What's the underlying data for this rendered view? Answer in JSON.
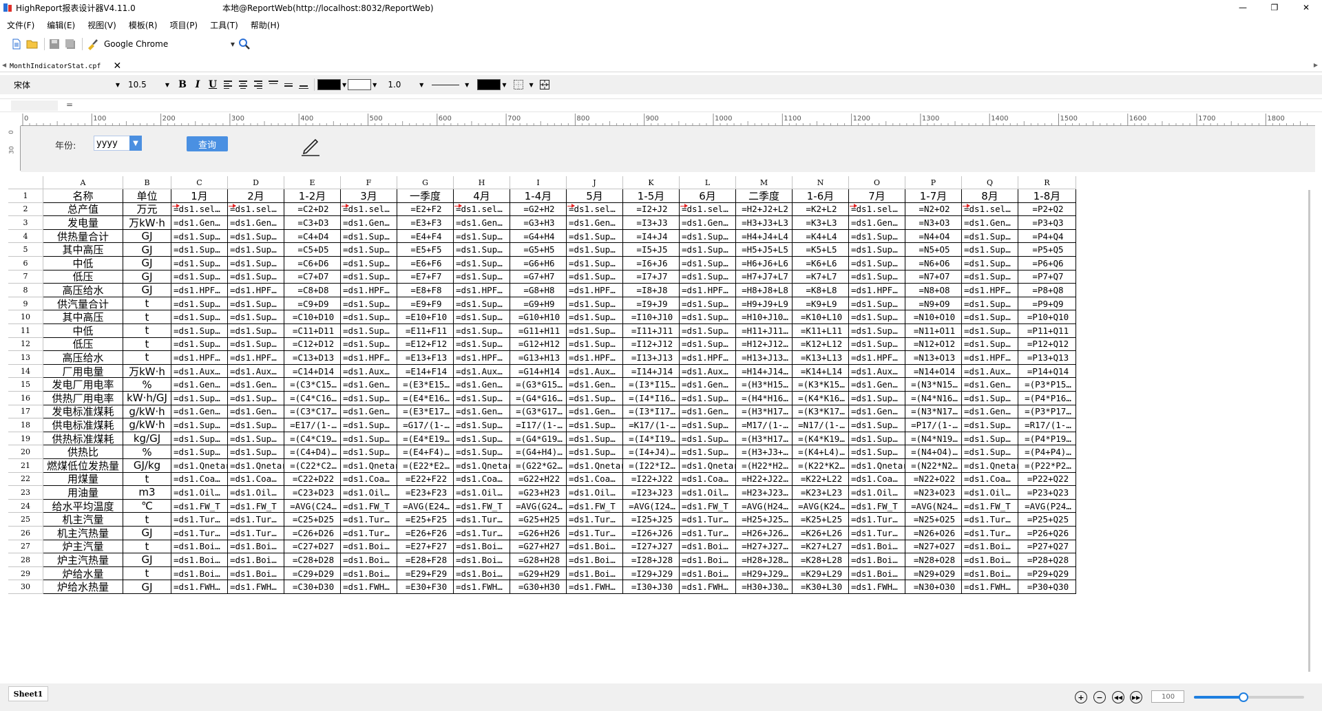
{
  "window": {
    "app_title": "HighReport报表设计器V4.11.0",
    "path_title": "本地@ReportWeb(http://localhost:8032/ReportWeb)",
    "min": "—",
    "max": "❐",
    "close": "✕"
  },
  "menu": [
    "文件(F)",
    "编辑(E)",
    "视图(V)",
    "模板(R)",
    "项目(P)",
    "工具(T)",
    "帮助(H)"
  ],
  "toolbar": {
    "browser": "Google Chrome"
  },
  "file_tab": {
    "name": "MonthIndicatorStat.cpf",
    "close": "✕"
  },
  "format_bar": {
    "font": "宋体",
    "size": "10.5",
    "bold": "B",
    "italic": "I",
    "underline": "U",
    "line_width": "1.0",
    "fg_color": "#000000",
    "bg_color": "#ffffff"
  },
  "formula_bar": {
    "eq": "="
  },
  "ruler": {
    "ticks": [
      "0",
      "100",
      "200",
      "300",
      "400",
      "500",
      "600",
      "700",
      "800",
      "900",
      "1000",
      "1100",
      "1200",
      "1300",
      "1400",
      "1500",
      "1600",
      "1700",
      "1800"
    ],
    "v_ticks": [
      "0",
      "30"
    ]
  },
  "params": {
    "year_label": "年份:",
    "year_value": "yyyy",
    "query_button": "查询"
  },
  "grid": {
    "columns": [
      "A",
      "B",
      "C",
      "D",
      "E",
      "F",
      "G",
      "H",
      "I",
      "J",
      "K",
      "L",
      "M",
      "N",
      "O",
      "P",
      "Q",
      "R"
    ],
    "rows": [
      {
        "n": "1",
        "c": [
          "名称",
          "单位",
          "1月",
          "2月",
          "1-2月",
          "3月",
          "一季度",
          "4月",
          "1-4月",
          "5月",
          "1-5月",
          "6月",
          "二季度",
          "1-6月",
          "7月",
          "1-7月",
          "8月",
          "1-8月"
        ]
      },
      {
        "n": "2",
        "c": [
          "总产值",
          "万元",
          "=ds1.sel…",
          "=ds1.sel…",
          "=C2+D2",
          "=ds1.sel…",
          "=E2+F2",
          "=ds1.sel…",
          "=G2+H2",
          "=ds1.sel…",
          "=I2+J2",
          "=ds1.sel…",
          "=H2+J2+L2",
          "=K2+L2",
          "=ds1.sel…",
          "=N2+O2",
          "=ds1.sel…",
          "=P2+Q2"
        ]
      },
      {
        "n": "3",
        "c": [
          "发电量",
          "万kW·h",
          "=ds1.Gen…",
          "=ds1.Gen…",
          "=C3+D3",
          "=ds1.Gen…",
          "=E3+F3",
          "=ds1.Gen…",
          "=G3+H3",
          "=ds1.Gen…",
          "=I3+J3",
          "=ds1.Gen…",
          "=H3+J3+L3",
          "=K3+L3",
          "=ds1.Gen…",
          "=N3+O3",
          "=ds1.Gen…",
          "=P3+Q3"
        ]
      },
      {
        "n": "4",
        "c": [
          "供热量合计",
          "GJ",
          "=ds1.Sup…",
          "=ds1.Sup…",
          "=C4+D4",
          "=ds1.Sup…",
          "=E4+F4",
          "=ds1.Sup…",
          "=G4+H4",
          "=ds1.Sup…",
          "=I4+J4",
          "=ds1.Sup…",
          "=H4+J4+L4",
          "=K4+L4",
          "=ds1.Sup…",
          "=N4+O4",
          "=ds1.Sup…",
          "=P4+Q4"
        ]
      },
      {
        "n": "5",
        "c": [
          "其中高压",
          "GJ",
          "=ds1.Sup…",
          "=ds1.Sup…",
          "=C5+D5",
          "=ds1.Sup…",
          "=E5+F5",
          "=ds1.Sup…",
          "=G5+H5",
          "=ds1.Sup…",
          "=I5+J5",
          "=ds1.Sup…",
          "=H5+J5+L5",
          "=K5+L5",
          "=ds1.Sup…",
          "=N5+O5",
          "=ds1.Sup…",
          "=P5+Q5"
        ]
      },
      {
        "n": "6",
        "c": [
          "中低",
          "GJ",
          "=ds1.Sup…",
          "=ds1.Sup…",
          "=C6+D6",
          "=ds1.Sup…",
          "=E6+F6",
          "=ds1.Sup…",
          "=G6+H6",
          "=ds1.Sup…",
          "=I6+J6",
          "=ds1.Sup…",
          "=H6+J6+L6",
          "=K6+L6",
          "=ds1.Sup…",
          "=N6+O6",
          "=ds1.Sup…",
          "=P6+Q6"
        ]
      },
      {
        "n": "7",
        "c": [
          "低压",
          "GJ",
          "=ds1.Sup…",
          "=ds1.Sup…",
          "=C7+D7",
          "=ds1.Sup…",
          "=E7+F7",
          "=ds1.Sup…",
          "=G7+H7",
          "=ds1.Sup…",
          "=I7+J7",
          "=ds1.Sup…",
          "=H7+J7+L7",
          "=K7+L7",
          "=ds1.Sup…",
          "=N7+O7",
          "=ds1.Sup…",
          "=P7+Q7"
        ]
      },
      {
        "n": "8",
        "c": [
          "高压给水",
          "GJ",
          "=ds1.HPF…",
          "=ds1.HPF…",
          "=C8+D8",
          "=ds1.HPF…",
          "=E8+F8",
          "=ds1.HPF…",
          "=G8+H8",
          "=ds1.HPF…",
          "=I8+J8",
          "=ds1.HPF…",
          "=H8+J8+L8",
          "=K8+L8",
          "=ds1.HPF…",
          "=N8+O8",
          "=ds1.HPF…",
          "=P8+Q8"
        ]
      },
      {
        "n": "9",
        "c": [
          "供汽量合计",
          "t",
          "=ds1.Sup…",
          "=ds1.Sup…",
          "=C9+D9",
          "=ds1.Sup…",
          "=E9+F9",
          "=ds1.Sup…",
          "=G9+H9",
          "=ds1.Sup…",
          "=I9+J9",
          "=ds1.Sup…",
          "=H9+J9+L9",
          "=K9+L9",
          "=ds1.Sup…",
          "=N9+O9",
          "=ds1.Sup…",
          "=P9+Q9"
        ]
      },
      {
        "n": "10",
        "c": [
          "其中高压",
          "t",
          "=ds1.Sup…",
          "=ds1.Sup…",
          "=C10+D10",
          "=ds1.Sup…",
          "=E10+F10",
          "=ds1.Sup…",
          "=G10+H10",
          "=ds1.Sup…",
          "=I10+J10",
          "=ds1.Sup…",
          "=H10+J10…",
          "=K10+L10",
          "=ds1.Sup…",
          "=N10+O10",
          "=ds1.Sup…",
          "=P10+Q10"
        ]
      },
      {
        "n": "11",
        "c": [
          "中低",
          "t",
          "=ds1.Sup…",
          "=ds1.Sup…",
          "=C11+D11",
          "=ds1.Sup…",
          "=E11+F11",
          "=ds1.Sup…",
          "=G11+H11",
          "=ds1.Sup…",
          "=I11+J11",
          "=ds1.Sup…",
          "=H11+J11…",
          "=K11+L11",
          "=ds1.Sup…",
          "=N11+O11",
          "=ds1.Sup…",
          "=P11+Q11"
        ]
      },
      {
        "n": "12",
        "c": [
          "低压",
          "t",
          "=ds1.Sup…",
          "=ds1.Sup…",
          "=C12+D12",
          "=ds1.Sup…",
          "=E12+F12",
          "=ds1.Sup…",
          "=G12+H12",
          "=ds1.Sup…",
          "=I12+J12",
          "=ds1.Sup…",
          "=H12+J12…",
          "=K12+L12",
          "=ds1.Sup…",
          "=N12+O12",
          "=ds1.Sup…",
          "=P12+Q12"
        ]
      },
      {
        "n": "13",
        "c": [
          "高压给水",
          "t",
          "=ds1.HPF…",
          "=ds1.HPF…",
          "=C13+D13",
          "=ds1.HPF…",
          "=E13+F13",
          "=ds1.HPF…",
          "=G13+H13",
          "=ds1.HPF…",
          "=I13+J13",
          "=ds1.HPF…",
          "=H13+J13…",
          "=K13+L13",
          "=ds1.HPF…",
          "=N13+O13",
          "=ds1.HPF…",
          "=P13+Q13"
        ]
      },
      {
        "n": "14",
        "c": [
          "厂用电量",
          "万kW·h",
          "=ds1.Aux…",
          "=ds1.Aux…",
          "=C14+D14",
          "=ds1.Aux…",
          "=E14+F14",
          "=ds1.Aux…",
          "=G14+H14",
          "=ds1.Aux…",
          "=I14+J14",
          "=ds1.Aux…",
          "=H14+J14…",
          "=K14+L14",
          "=ds1.Aux…",
          "=N14+O14",
          "=ds1.Aux…",
          "=P14+Q14"
        ]
      },
      {
        "n": "15",
        "c": [
          "发电厂用电率",
          "%",
          "=ds1.Gen…",
          "=ds1.Gen…",
          "=(C3*C15…",
          "=ds1.Gen…",
          "=(E3*E15…",
          "=ds1.Gen…",
          "=(G3*G15…",
          "=ds1.Gen…",
          "=(I3*I15…",
          "=ds1.Gen…",
          "=(H3*H15…",
          "=(K3*K15…",
          "=ds1.Gen…",
          "=(N3*N15…",
          "=ds1.Gen…",
          "=(P3*P15…"
        ]
      },
      {
        "n": "16",
        "c": [
          "供热厂用电率",
          "kW·h/GJ",
          "=ds1.Sup…",
          "=ds1.Sup…",
          "=(C4*C16…",
          "=ds1.Sup…",
          "=(E4*E16…",
          "=ds1.Sup…",
          "=(G4*G16…",
          "=ds1.Sup…",
          "=(I4*I16…",
          "=ds1.Sup…",
          "=(H4*H16…",
          "=(K4*K16…",
          "=ds1.Sup…",
          "=(N4*N16…",
          "=ds1.Sup…",
          "=(P4*P16…"
        ]
      },
      {
        "n": "17",
        "c": [
          "发电标准煤耗",
          "g/kW·h",
          "=ds1.Gen…",
          "=ds1.Gen…",
          "=(C3*C17…",
          "=ds1.Gen…",
          "=(E3*E17…",
          "=ds1.Gen…",
          "=(G3*G17…",
          "=ds1.Gen…",
          "=(I3*I17…",
          "=ds1.Gen…",
          "=(H3*H17…",
          "=(K3*K17…",
          "=ds1.Gen…",
          "=(N3*N17…",
          "=ds1.Gen…",
          "=(P3*P17…"
        ]
      },
      {
        "n": "18",
        "c": [
          "供电标准煤耗",
          "g/kW·h",
          "=ds1.Sup…",
          "=ds1.Sup…",
          "=E17/(1-…",
          "=ds1.Sup…",
          "=G17/(1-…",
          "=ds1.Sup…",
          "=I17/(1-…",
          "=ds1.Sup…",
          "=K17/(1-…",
          "=ds1.Sup…",
          "=M17/(1-…",
          "=N17/(1-…",
          "=ds1.Sup…",
          "=P17/(1-…",
          "=ds1.Sup…",
          "=R17/(1-…"
        ]
      },
      {
        "n": "19",
        "c": [
          "供热标准煤耗",
          "kg/GJ",
          "=ds1.Sup…",
          "=ds1.Sup…",
          "=(C4*C19…",
          "=ds1.Sup…",
          "=(E4*E19…",
          "=ds1.Sup…",
          "=(G4*G19…",
          "=ds1.Sup…",
          "=(I4*I19…",
          "=ds1.Sup…",
          "=(H3*H17…",
          "=(K4*K19…",
          "=ds1.Sup…",
          "=(N4*N19…",
          "=ds1.Sup…",
          "=(P4*P19…"
        ]
      },
      {
        "n": "20",
        "c": [
          "供热比",
          "%",
          "=ds1.Sup…",
          "=ds1.Sup…",
          "=(C4+D4)…",
          "=ds1.Sup…",
          "=(E4+F4)…",
          "=ds1.Sup…",
          "=(G4+H4)…",
          "=ds1.Sup…",
          "=(I4+J4)…",
          "=ds1.Sup…",
          "=(H3+J3+…",
          "=(K4+L4)…",
          "=ds1.Sup…",
          "=(N4+O4)…",
          "=ds1.Sup…",
          "=(P4+P4)…"
        ]
      },
      {
        "n": "21",
        "c": [
          "燃煤低位发热量",
          "GJ/kg",
          "=ds1.Qnetar",
          "=ds1.Qnetar",
          "=(C22*C2…",
          "=ds1.Qnetar",
          "=(E22*E2…",
          "=ds1.Qnetar",
          "=(G22*G2…",
          "=ds1.Qnetar",
          "=(I22*I2…",
          "=ds1.Qnetar",
          "=(H22*H2…",
          "=(K22*K2…",
          "=ds1.Qnetar",
          "=(N22*N2…",
          "=ds1.Qnetar",
          "=(P22*P2…"
        ]
      },
      {
        "n": "22",
        "c": [
          "用煤量",
          "t",
          "=ds1.Coa…",
          "=ds1.Coa…",
          "=C22+D22",
          "=ds1.Coa…",
          "=E22+F22",
          "=ds1.Coa…",
          "=G22+H22",
          "=ds1.Coa…",
          "=I22+J22",
          "=ds1.Coa…",
          "=H22+J22…",
          "=K22+L22",
          "=ds1.Coa…",
          "=N22+O22",
          "=ds1.Coa…",
          "=P22+Q22"
        ]
      },
      {
        "n": "23",
        "c": [
          "用油量",
          "m3",
          "=ds1.Oil…",
          "=ds1.Oil…",
          "=C23+D23",
          "=ds1.Oil…",
          "=E23+F23",
          "=ds1.Oil…",
          "=G23+H23",
          "=ds1.Oil…",
          "=I23+J23",
          "=ds1.Oil…",
          "=H23+J23…",
          "=K23+L23",
          "=ds1.Oil…",
          "=N23+O23",
          "=ds1.Oil…",
          "=P23+Q23"
        ]
      },
      {
        "n": "24",
        "c": [
          "给水平均温度",
          "℃",
          "=ds1.FW_T",
          "=ds1.FW_T",
          "=AVG(C24…",
          "=ds1.FW_T",
          "=AVG(E24…",
          "=ds1.FW_T",
          "=AVG(G24…",
          "=ds1.FW_T",
          "=AVG(I24…",
          "=ds1.FW_T",
          "=AVG(H24…",
          "=AVG(K24…",
          "=ds1.FW_T",
          "=AVG(N24…",
          "=ds1.FW_T",
          "=AVG(P24…"
        ]
      },
      {
        "n": "25",
        "c": [
          "机主汽量",
          "t",
          "=ds1.Tur…",
          "=ds1.Tur…",
          "=C25+D25",
          "=ds1.Tur…",
          "=E25+F25",
          "=ds1.Tur…",
          "=G25+H25",
          "=ds1.Tur…",
          "=I25+J25",
          "=ds1.Tur…",
          "=H25+J25…",
          "=K25+L25",
          "=ds1.Tur…",
          "=N25+O25",
          "=ds1.Tur…",
          "=P25+Q25"
        ]
      },
      {
        "n": "26",
        "c": [
          "机主汽热量",
          "GJ",
          "=ds1.Tur…",
          "=ds1.Tur…",
          "=C26+D26",
          "=ds1.Tur…",
          "=E26+F26",
          "=ds1.Tur…",
          "=G26+H26",
          "=ds1.Tur…",
          "=I26+J26",
          "=ds1.Tur…",
          "=H26+J26…",
          "=K26+L26",
          "=ds1.Tur…",
          "=N26+O26",
          "=ds1.Tur…",
          "=P26+Q26"
        ]
      },
      {
        "n": "27",
        "c": [
          "炉主汽量",
          "t",
          "=ds1.Boi…",
          "=ds1.Boi…",
          "=C27+D27",
          "=ds1.Boi…",
          "=E27+F27",
          "=ds1.Boi…",
          "=G27+H27",
          "=ds1.Boi…",
          "=I27+J27",
          "=ds1.Boi…",
          "=H27+J27…",
          "=K27+L27",
          "=ds1.Boi…",
          "=N27+O27",
          "=ds1.Boi…",
          "=P27+Q27"
        ]
      },
      {
        "n": "28",
        "c": [
          "炉主汽热量",
          "GJ",
          "=ds1.Boi…",
          "=ds1.Boi…",
          "=C28+D28",
          "=ds1.Boi…",
          "=E28+F28",
          "=ds1.Boi…",
          "=G28+H28",
          "=ds1.Boi…",
          "=I28+J28",
          "=ds1.Boi…",
          "=H28+J28…",
          "=K28+L28",
          "=ds1.Boi…",
          "=N28+O28",
          "=ds1.Boi…",
          "=P28+Q28"
        ]
      },
      {
        "n": "29",
        "c": [
          "炉给水量",
          "t",
          "=ds1.Boi…",
          "=ds1.Boi…",
          "=C29+D29",
          "=ds1.Boi…",
          "=E29+F29",
          "=ds1.Boi…",
          "=G29+H29",
          "=ds1.Boi…",
          "=I29+J29",
          "=ds1.Boi…",
          "=H29+J29…",
          "=K29+L29",
          "=ds1.Boi…",
          "=N29+O29",
          "=ds1.Boi…",
          "=P29+Q29"
        ]
      },
      {
        "n": "30",
        "c": [
          "炉给水热量",
          "GJ",
          "=ds1.FWH…",
          "=ds1.FWH…",
          "=C30+D30",
          "=ds1.FWH…",
          "=E30+F30",
          "=ds1.FWH…",
          "=G30+H30",
          "=ds1.FWH…",
          "=I30+J30",
          "=ds1.FWH…",
          "=H30+J30…",
          "=K30+L30",
          "=ds1.FWH…",
          "=N30+O30",
          "=ds1.FWH…",
          "=P30+Q30"
        ]
      }
    ]
  },
  "bottom": {
    "sheet": "Sheet1",
    "zoom": "100",
    "zoom_percent": 0.45
  }
}
